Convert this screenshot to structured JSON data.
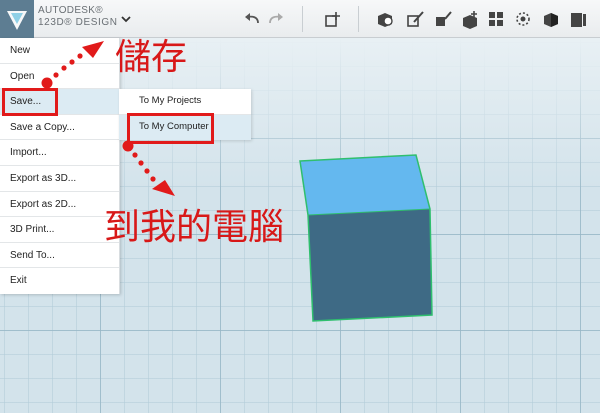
{
  "app": {
    "brand_line1": "AUTODESK®",
    "brand_line2": "123D® DESIGN"
  },
  "toolbar": {
    "icons": [
      "undo-icon",
      "redo-icon",
      "transform-icon",
      "primitives-icon",
      "sketch-icon",
      "construct-icon",
      "modify-icon",
      "pattern-icon",
      "grouping-icon",
      "combine-icon",
      "measure-icon",
      "text-icon",
      "snap-icon"
    ]
  },
  "main_menu": {
    "items": [
      {
        "label": "New"
      },
      {
        "label": "Open"
      },
      {
        "label": "Save..."
      },
      {
        "label": "Save a Copy..."
      },
      {
        "label": "Import..."
      },
      {
        "label": "Export as 3D..."
      },
      {
        "label": "Export as 2D..."
      },
      {
        "label": "3D Print..."
      },
      {
        "label": "Send To..."
      },
      {
        "label": "Exit"
      }
    ],
    "active_index": 2
  },
  "save_submenu": {
    "items": [
      {
        "label": "To My Projects"
      },
      {
        "label": "To My Computer"
      }
    ],
    "active_index": 1
  },
  "annotations": {
    "save_note": "儲存",
    "computer_note": "到我的電腦"
  },
  "colors": {
    "accent_red": "#e11a1a",
    "cube_top": "#64b8ef",
    "cube_front": "#3e6a85",
    "cube_edge": "#2fbf6e",
    "menu_highlight": "#dcebf3"
  }
}
